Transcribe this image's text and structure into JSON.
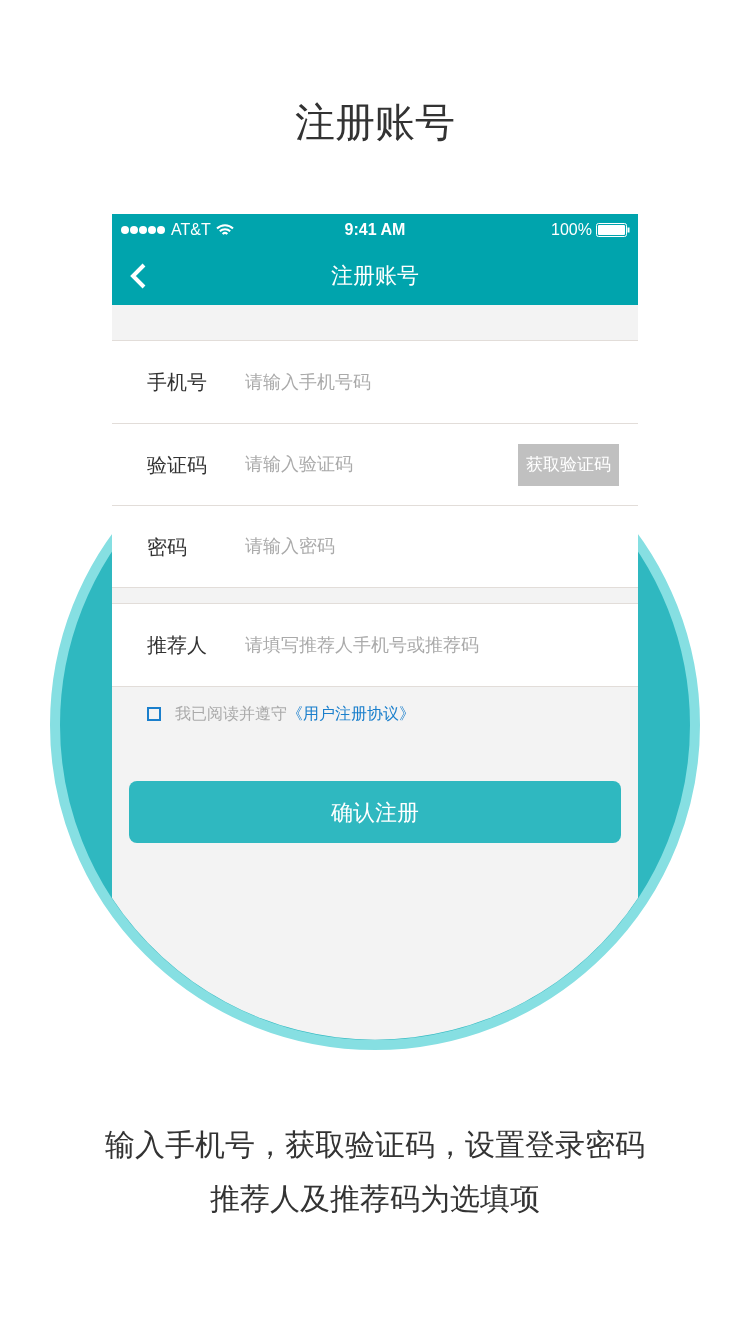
{
  "heading": "注册账号",
  "status_bar": {
    "carrier": "AT&T",
    "time": "9:41 AM",
    "battery": "100%"
  },
  "nav": {
    "title": "注册账号"
  },
  "field_groups": [
    {
      "fields": [
        {
          "kind": "plain",
          "label": "手机号",
          "placeholder": "请输入手机号码"
        },
        {
          "kind": "with_button",
          "label": "验证码",
          "placeholder": "请输入验证码",
          "button": "获取验证码"
        },
        {
          "kind": "plain",
          "label": "密码",
          "placeholder": "请输入密码"
        }
      ]
    },
    {
      "fields": [
        {
          "kind": "plain",
          "label": "推荐人",
          "placeholder": "请填写推荐人手机号或推荐码"
        }
      ]
    }
  ],
  "agreement": {
    "checked": false,
    "text": "我已阅读并遵守",
    "link": "《用户注册协议》"
  },
  "submit": "确认注册",
  "caption": [
    "输入手机号，获取验证码，设置登录密码",
    "推荐人及推荐码为选填项"
  ]
}
